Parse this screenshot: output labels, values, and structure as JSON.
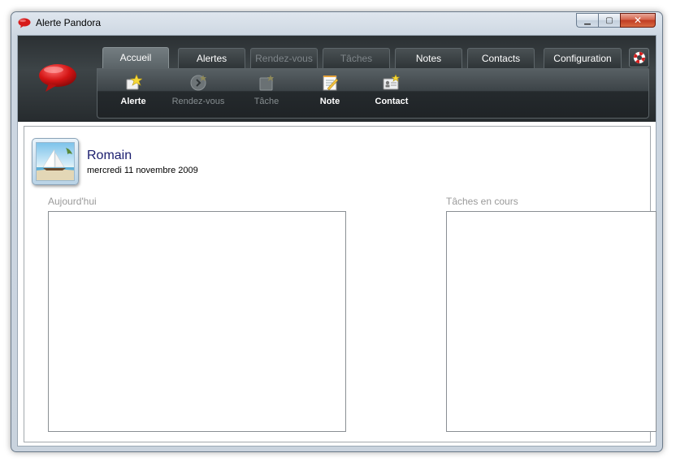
{
  "window": {
    "title": "Alerte Pandora",
    "controls": {
      "minimize": "minimize-icon",
      "maximize": "maximize-icon",
      "close": "close-icon"
    }
  },
  "tabs": [
    {
      "label": "Accueil",
      "active": true,
      "enabled": true
    },
    {
      "label": "Alertes",
      "active": false,
      "enabled": true
    },
    {
      "label": "Rendez-vous",
      "active": false,
      "enabled": false
    },
    {
      "label": "Tâches",
      "active": false,
      "enabled": false
    },
    {
      "label": "Notes",
      "active": false,
      "enabled": true
    },
    {
      "label": "Contacts",
      "active": false,
      "enabled": true
    },
    {
      "label": "Configuration",
      "active": false,
      "enabled": true
    }
  ],
  "help_icon": "lifebuoy-icon",
  "toolbar": [
    {
      "label": "Alerte",
      "icon": "new-alert-icon",
      "enabled": true
    },
    {
      "label": "Rendez-vous",
      "icon": "new-appointment-icon",
      "enabled": false
    },
    {
      "label": "Tâche",
      "icon": "new-task-icon",
      "enabled": false
    },
    {
      "label": "Note",
      "icon": "new-note-icon",
      "enabled": true
    },
    {
      "label": "Contact",
      "icon": "new-contact-icon",
      "enabled": true
    }
  ],
  "user": {
    "name": "Romain",
    "date": "mercredi 11 novembre 2009",
    "avatar_icon": "sailboat-avatar-icon"
  },
  "sections": {
    "today": "Aujourd'hui",
    "tasks": "Tâches en cours"
  },
  "colors": {
    "header_dark": "#2b3033",
    "user_name": "#1a1d6e",
    "section_label": "#9a9a9a",
    "brand_red": "#d61a1a"
  }
}
